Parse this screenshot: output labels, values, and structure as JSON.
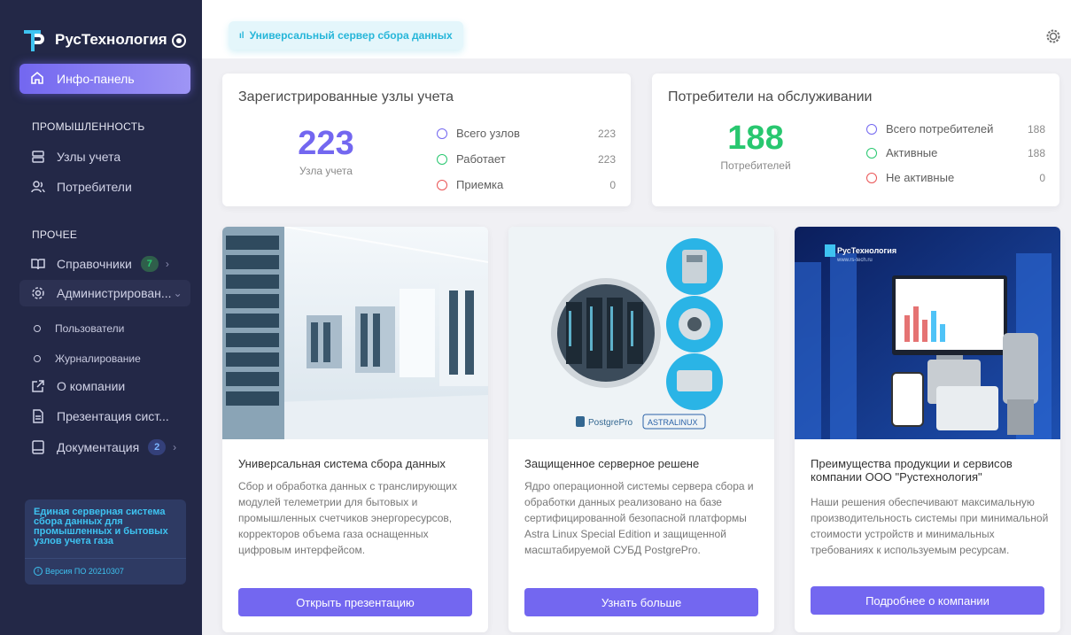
{
  "brand": {
    "name": "РусТехнология"
  },
  "topbar": {
    "chip": "Универсальный сервер сбора данных"
  },
  "nav": {
    "dashboard": "Инфо-панель",
    "section_industry": "ПРОМЫШЛЕННОСТЬ",
    "nodes": "Узлы учета",
    "consumers": "Потребители",
    "section_other": "ПРОЧЕЕ",
    "directories": "Справочники",
    "directories_badge": "7",
    "admin": "Администрирован...",
    "users": "Пользователи",
    "logging": "Журналирование",
    "about": "О компании",
    "presentation": "Презентация сист...",
    "docs": "Документация",
    "docs_badge": "2"
  },
  "promo": {
    "title": "Единая серверная система сбора данных для промышленных и бытовых узлов учета газа",
    "version": "Версия ПО 20210307"
  },
  "nodes_card": {
    "title": "Зарегистрированные узлы учета",
    "total": "223",
    "total_label": "Узла учета",
    "rows": [
      {
        "label": "Всего узлов",
        "value": "223",
        "color": "#7367f0"
      },
      {
        "label": "Работает",
        "value": "223",
        "color": "#28c76f"
      },
      {
        "label": "Приемка",
        "value": "0",
        "color": "#ea5455"
      }
    ],
    "num_color": "#7367f0"
  },
  "consumers_card": {
    "title": "Потребители на обслуживании",
    "total": "188",
    "total_label": "Потребителей",
    "rows": [
      {
        "label": "Всего потребителей",
        "value": "188",
        "color": "#7367f0"
      },
      {
        "label": "Активные",
        "value": "188",
        "color": "#28c76f"
      },
      {
        "label": "Не активные",
        "value": "0",
        "color": "#ea5455"
      }
    ],
    "num_color": "#28c76f"
  },
  "features": [
    {
      "title": "Универсальная система сбора данных",
      "text": "Сбор и обработка данных с транслирующих модулей телеметрии для бытовых и промышленных счетчиков энергоресурсов, корректоров объема газа оснащенных цифровым интерфейсом.",
      "button": "Открыть презентацию"
    },
    {
      "title": "Защищенное серверное решене",
      "text": "Ядро операционной системы сервера сбора и обработки данных реализовано на базе сертифицированной безопасной платформы Astra Linux Special Edition и защищенной масштабируемой СУБД PostgrePro.",
      "button": "Узнать больше",
      "logo_pg": "PostgrePro",
      "logo_astra": "ASTRALINUX"
    },
    {
      "title": "Преимущества продукции и сервисов компании ООО \"Рустехнология\"",
      "text": "Наши решения обеспечивают максимальную производительность системы при минимальной стоимости устройств и минимальных требованиях к используемым ресурсам.",
      "button": "Подробнее о компании",
      "brand_text": "РусТехнология",
      "brand_url": "www.rs-tech.ru"
    }
  ]
}
